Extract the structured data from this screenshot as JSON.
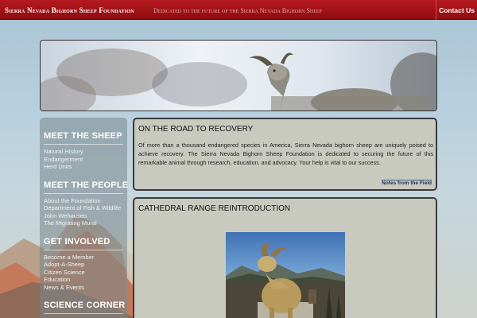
{
  "header": {
    "site_title": "Sierra Nevada Bighorn Sheep Foundation",
    "tagline": "Dedicated to the future of the Sierra Nevada Bighorn Sheep",
    "contact_label": "Contact Us"
  },
  "sidebar": {
    "sections": [
      {
        "heading": "MEET THE SHEEP",
        "items": [
          "Natural History",
          "Endangerment",
          "Herd Units"
        ]
      },
      {
        "heading": "MEET THE PEOPLE",
        "items": [
          "About the Foundation",
          "Department of Fish & Wildlife",
          "John Wehausen",
          "The Migrating Mural"
        ]
      },
      {
        "heading": "GET INVOLVED",
        "items": [
          "Become a Member",
          "Adopt-A-Sheep",
          "Citizen Science",
          "Education",
          "News & Events"
        ]
      },
      {
        "heading": "SCIENCE CORNER",
        "items": []
      }
    ]
  },
  "main": {
    "intro": {
      "title": "ON THE ROAD TO RECOVERY",
      "body": "Of more than a thousand endangered species in America, Sierra Nevada bighorn sheep are uniquely poised to achieve recovery. The Sierra Nevada Bighorn Sheep Foundation is dedicated to securing the future of this remarkable animal through research, education, and advocacy. Your help is vital to our success.",
      "link_label": "Notes from the Field"
    },
    "feature": {
      "title": "CATHEDRAL RANGE REINTRODUCTION"
    }
  },
  "colors": {
    "header_red": "#a3141a",
    "panel_bg": "#c8cac0",
    "sidebar_bg": "#78878c"
  }
}
